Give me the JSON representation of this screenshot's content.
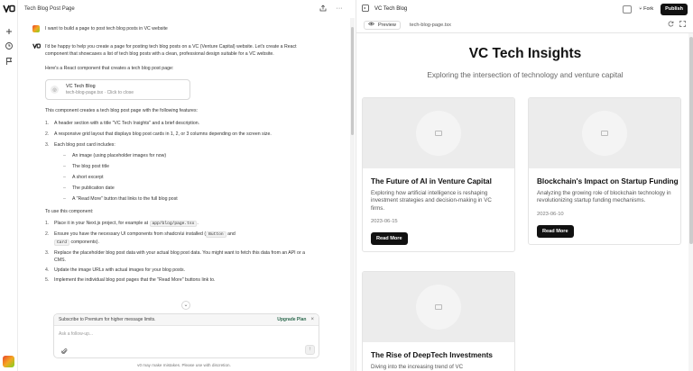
{
  "chat": {
    "title": "Tech Blog Post Page",
    "user_message": "I want to build a page to post tech blog posts in VC website",
    "intro": "I'd be happy to help you create a page for posting tech blog posts on a VC (Venture Capital) website. Let's create a React component that showcases a list of tech blog posts with a clean, professional design suitable for a VC website.",
    "lead": "Here's a React component that creates a tech blog post page:",
    "code_card": {
      "title": "VC Tech Blog",
      "subtitle": "tech-blog-page.tsx · Click to close"
    },
    "features_intro": "This component creates a tech blog post page with the following features:",
    "features": [
      "A header section with a title \"VC Tech Insights\" and a brief description.",
      "A responsive grid layout that displays blog post cards in 1, 2, or 3 columns depending on the screen size.",
      "Each blog post card includes:"
    ],
    "card_parts": [
      "An image (using placeholder images for now)",
      "The blog post title",
      "A short excerpt",
      "The publication date",
      "A \"Read More\" button that links to the full blog post"
    ],
    "use_intro": "To use this component:",
    "steps": [
      {
        "pre": "Place it in your Next.js project, for example at ",
        "code": "app/blog/page.tsx",
        "post": "."
      },
      {
        "pre": "Ensure you have the necessary UI components from shadcn/ui installed (",
        "code": "Button",
        "mid": " and ",
        "code2": "Card",
        "post": " components)."
      },
      {
        "pre": "Replace the placeholder blog post data with your actual blog post data. You might want to fetch this data from an API or a CMS."
      },
      {
        "pre": "Update the image URLs with actual images for your blog posts."
      },
      {
        "pre": "Implement the individual blog post pages that the \"Read More\" buttons link to."
      }
    ],
    "promo_text": "Subscribe to Premium for higher message limits.",
    "promo_link": "Upgrade Plan",
    "input_placeholder": "Ask a follow-up...",
    "disclaimer": "v0 may make mistakes. Please use with discretion."
  },
  "preview": {
    "title": "VC Tech Blog",
    "fork_label": "Fork",
    "publish_label": "Publish",
    "tab_preview": "Preview",
    "tab_file": "tech-blog-page.tsx",
    "site_title": "VC Tech Insights",
    "site_subtitle": "Exploring the intersection of technology and venture capital",
    "read_more": "Read More",
    "posts": [
      {
        "title": "The Future of AI in Venture Capital",
        "excerpt": "Exploring how artificial intelligence is reshaping investment strategies and decision-making in VC firms.",
        "date": "2023-06-15"
      },
      {
        "title": "Blockchain's Impact on Startup Funding",
        "excerpt": "Analyzing the growing role of blockchain technology in revolutionizing startup funding mechanisms.",
        "date": "2023-06-10"
      },
      {
        "title": "The Rise of DeepTech Investments",
        "excerpt": "Diving into the increasing trend of VC",
        "date": ""
      }
    ]
  }
}
